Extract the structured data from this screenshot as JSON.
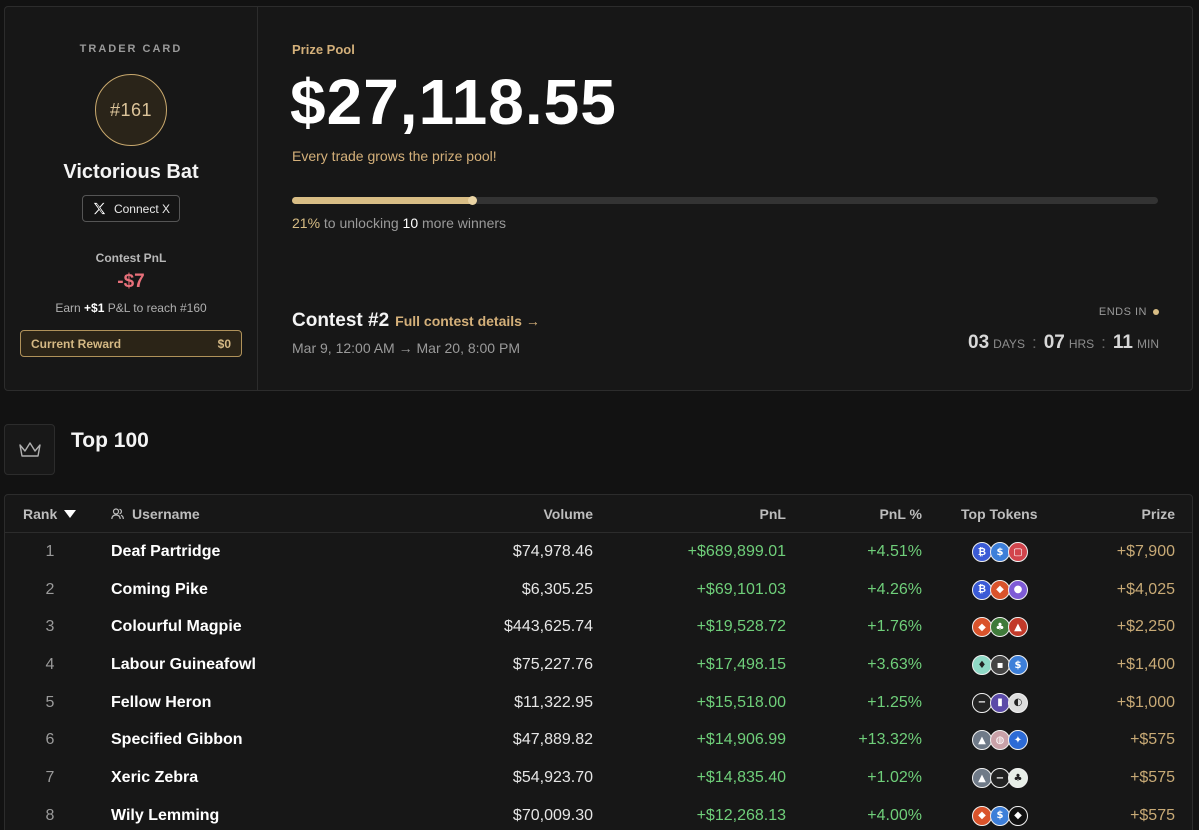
{
  "trader_card": {
    "heading": "TRADER CARD",
    "rank_badge": "#161",
    "name": "Victorious Bat",
    "connect_label": "Connect X",
    "pnl_label": "Contest PnL",
    "pnl_value": "-$7",
    "earn_prefix": "Earn",
    "earn_amount": "+$1",
    "earn_suffix": "P&L to reach #160",
    "reward_label": "Current Reward",
    "reward_value": "$0"
  },
  "prize_pool": {
    "label": "Prize Pool",
    "amount": "$27,118.55",
    "subtitle": "Every trade grows the prize pool!",
    "progress_fraction": 0.21,
    "progress_pct_text": "21%",
    "progress_mid": "to unlocking",
    "progress_count": "10",
    "progress_tail": "more winners"
  },
  "contest": {
    "name": "Contest #2",
    "details_link": "Full contest details →",
    "dates": "Mar 9, 12:00 AM → Mar 20, 8:00 PM",
    "ends_label": "ENDS IN",
    "days": "03",
    "days_unit": "DAYS",
    "hours": "07",
    "hours_unit": "HRS",
    "mins": "11",
    "mins_unit": "MIN",
    "sep": ":"
  },
  "leaderboard": {
    "title": "Top 100",
    "columns": {
      "rank": "Rank",
      "username": "Username",
      "volume": "Volume",
      "pnl": "PnL",
      "pnl_pct": "PnL %",
      "top_tokens": "Top Tokens",
      "prize": "Prize"
    },
    "rows": [
      {
        "rank": "1",
        "username": "Deaf Partridge",
        "volume": "$74,978.46",
        "pnl": "+$689,899.01",
        "pnl_pct": "+4.51%",
        "prize": "+$7,900",
        "tokens": [
          "bitcoin-icon",
          "usdc-icon",
          "square-token-icon"
        ]
      },
      {
        "rank": "2",
        "username": "Coming Pike",
        "volume": "$6,305.25",
        "pnl": "+$69,101.03",
        "pnl_pct": "+4.26%",
        "prize": "+$4,025",
        "tokens": [
          "bitcoin-icon",
          "orange-token-icon",
          "purple-token-icon"
        ]
      },
      {
        "rank": "3",
        "username": "Colourful Magpie",
        "volume": "$443,625.74",
        "pnl": "+$19,528.72",
        "pnl_pct": "+1.76%",
        "prize": "+$2,250",
        "tokens": [
          "orange-token-icon",
          "green-token-icon",
          "red-triangle-token-icon"
        ]
      },
      {
        "rank": "4",
        "username": "Labour Guineafowl",
        "volume": "$75,227.76",
        "pnl": "+$17,498.15",
        "pnl_pct": "+3.63%",
        "prize": "+$1,400",
        "tokens": [
          "teal-token-icon",
          "dark-token-icon",
          "usdc-icon"
        ]
      },
      {
        "rank": "5",
        "username": "Fellow Heron",
        "volume": "$11,322.95",
        "pnl": "+$15,518.00",
        "pnl_pct": "+1.25%",
        "prize": "+$1,000",
        "tokens": [
          "minus-token-icon",
          "bars-token-icon",
          "white-token-icon"
        ]
      },
      {
        "rank": "6",
        "username": "Specified Gibbon",
        "volume": "$47,889.82",
        "pnl": "+$14,906.99",
        "pnl_pct": "+13.32%",
        "prize": "+$575",
        "tokens": [
          "grey-token-icon",
          "pink-token-icon",
          "blue-token-icon"
        ]
      },
      {
        "rank": "7",
        "username": "Xeric Zebra",
        "volume": "$54,923.70",
        "pnl": "+$14,835.40",
        "pnl_pct": "+1.02%",
        "prize": "+$575",
        "tokens": [
          "grey-token-icon",
          "minus-token-icon",
          "tree-token-icon"
        ]
      },
      {
        "rank": "8",
        "username": "Wily Lemming",
        "volume": "$70,009.30",
        "pnl": "+$12,268.13",
        "pnl_pct": "+4.00%",
        "prize": "+$575",
        "tokens": [
          "orange-token-icon",
          "usdc-icon",
          "black-token-icon"
        ]
      }
    ]
  },
  "token_colors": {
    "bitcoin-icon": "#3b5bd6",
    "usdc-icon": "#3d7fd9",
    "square-token-icon": "#d2444c",
    "orange-token-icon": "#d9532b",
    "purple-token-icon": "#7e5bd6",
    "green-token-icon": "#3f7a3a",
    "red-triangle-token-icon": "#c23a2a",
    "teal-token-icon": "#8fd9c6",
    "dark-token-icon": "#444444",
    "minus-token-icon": "#222222",
    "bars-token-icon": "#5b4aa8",
    "white-token-icon": "#dddddd",
    "grey-token-icon": "#6f7a88",
    "pink-token-icon": "#c9a1a8",
    "blue-token-icon": "#2d6bd6",
    "tree-token-icon": "#e8efe8",
    "black-token-icon": "#111111"
  },
  "token_glyphs": {
    "bitcoin-icon": "₿",
    "usdc-icon": "$",
    "square-token-icon": "▢",
    "orange-token-icon": "◆",
    "purple-token-icon": "●",
    "green-token-icon": "♣",
    "red-triangle-token-icon": "▲",
    "teal-token-icon": "♦",
    "dark-token-icon": "▪",
    "minus-token-icon": "−",
    "bars-token-icon": "▮",
    "white-token-icon": "◐",
    "grey-token-icon": "▲",
    "pink-token-icon": "◍",
    "blue-token-icon": "✦",
    "tree-token-icon": "♣",
    "black-token-icon": "◆"
  }
}
